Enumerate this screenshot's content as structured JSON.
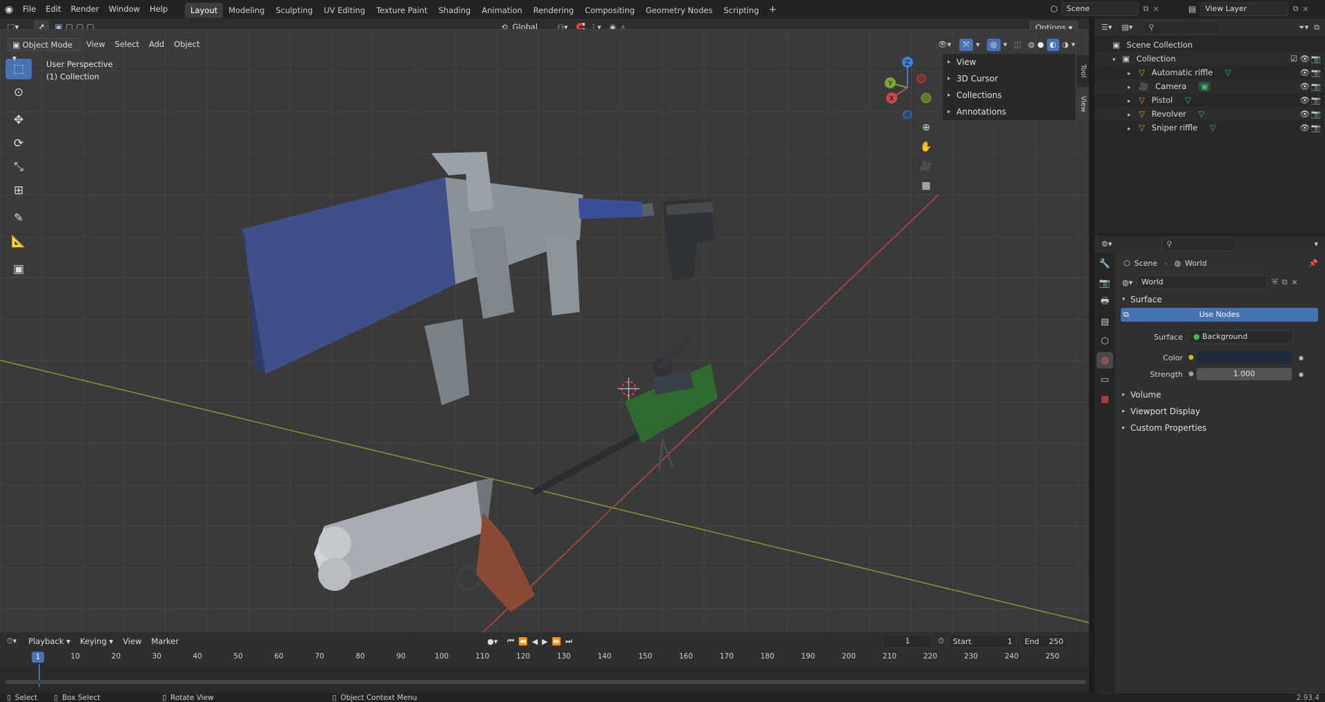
{
  "menu": {
    "items": [
      "File",
      "Edit",
      "Render",
      "Window",
      "Help"
    ]
  },
  "workspaces": [
    "Layout",
    "Modeling",
    "Sculpting",
    "UV Editing",
    "Texture Paint",
    "Shading",
    "Animation",
    "Rendering",
    "Compositing",
    "Geometry Nodes",
    "Scripting"
  ],
  "active_workspace": "Layout",
  "scene": {
    "name": "Scene",
    "view_layer": "View Layer"
  },
  "viewport": {
    "mode": "Object Mode",
    "menus": [
      "View",
      "Select",
      "Add",
      "Object"
    ],
    "transform_orientation": "Global",
    "options_label": "Options",
    "overlay_title": "User Perspective",
    "overlay_subtitle": "(1) Collection",
    "gizmo_axes": {
      "x": "X",
      "y": "Y",
      "z": "Z"
    },
    "npanel": {
      "sections": [
        "View",
        "3D Cursor",
        "Collections",
        "Annotations"
      ],
      "tabs": [
        "Tool",
        "View"
      ]
    }
  },
  "outliner": {
    "root": "Scene Collection",
    "collection": "Collection",
    "objects": [
      {
        "name": "Automatic riffle",
        "type": "mesh"
      },
      {
        "name": "Camera",
        "type": "camera"
      },
      {
        "name": "Pistol",
        "type": "mesh"
      },
      {
        "name": "Revolver",
        "type": "mesh"
      },
      {
        "name": "Sniper riffle",
        "type": "mesh"
      }
    ]
  },
  "properties": {
    "breadcrumb_scene": "Scene",
    "breadcrumb_world": "World",
    "world_name": "World",
    "surface_section": "Surface",
    "use_nodes_label": "Use Nodes",
    "surface_label": "Surface",
    "surface_value": "Background",
    "color_label": "Color",
    "color_value": "#1f2b3a",
    "strength_label": "Strength",
    "strength_value": "1.000",
    "collapsed_sections": [
      "Volume",
      "Viewport Display",
      "Custom Properties"
    ]
  },
  "timeline": {
    "menus": [
      "Playback",
      "Keying",
      "View",
      "Marker"
    ],
    "current_frame": "1",
    "start_label": "Start",
    "start_value": "1",
    "end_label": "End",
    "end_value": "250",
    "ruler": [
      "10",
      "20",
      "30",
      "40",
      "50",
      "60",
      "70",
      "80",
      "90",
      "100",
      "110",
      "120",
      "130",
      "140",
      "150",
      "160",
      "170",
      "180",
      "190",
      "200",
      "210",
      "220",
      "230",
      "240",
      "250"
    ],
    "playhead": "1"
  },
  "status": {
    "select": "Select",
    "box_select": "Box Select",
    "rotate_view": "Rotate View",
    "context_menu": "Object Context Menu",
    "version": "2.93.4"
  },
  "colors": {
    "accent": "#4772b3",
    "x_axis": "#c94a4a",
    "y_axis": "#7fa32e",
    "z_axis": "#3d7fd6"
  }
}
